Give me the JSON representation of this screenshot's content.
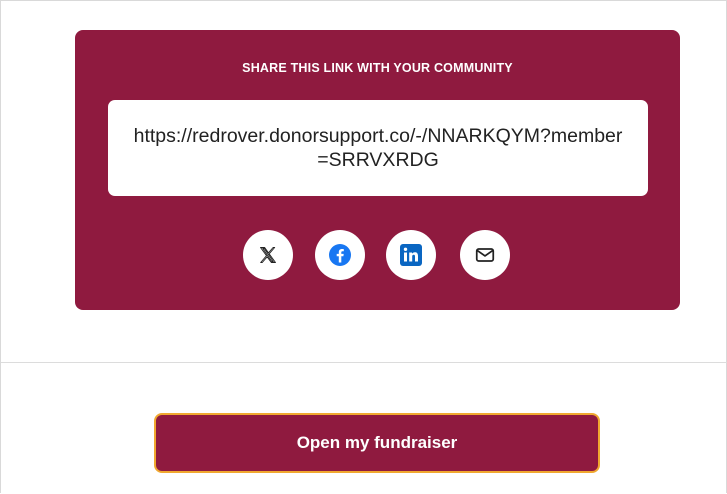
{
  "share": {
    "heading": "SHARE THIS LINK WITH YOUR COMMUNITY",
    "link": "https://redrover.donorsupport.co/-/NNARKQYM?member=SRRVXRDG",
    "icons": [
      "x-icon",
      "facebook-icon",
      "linkedin-icon",
      "email-icon"
    ]
  },
  "actions": {
    "open_label": "Open my fundraiser"
  },
  "colors": {
    "brand": "#8f1a3f",
    "button_border": "#f0a830",
    "facebook": "#1877f2",
    "linkedin": "#0a66c2"
  }
}
